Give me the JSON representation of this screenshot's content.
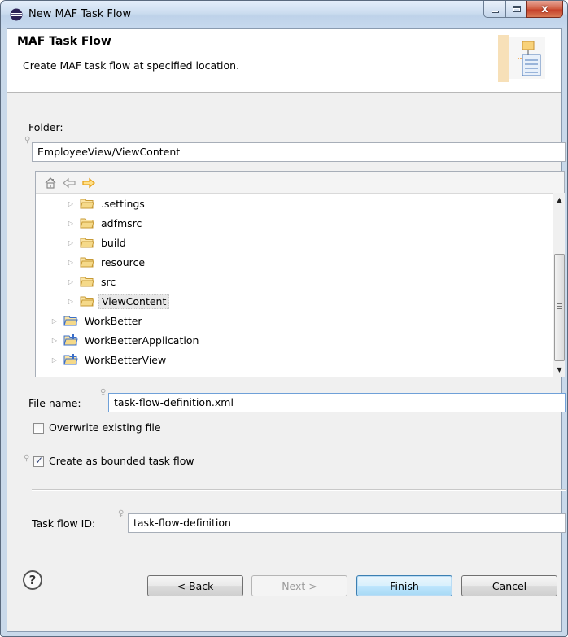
{
  "window": {
    "title": "New MAF Task Flow",
    "close_glyph": "x"
  },
  "header": {
    "title": "MAF Task Flow",
    "description": "Create MAF task flow at specified location."
  },
  "folder": {
    "label": "Folder:",
    "value": "EmployeeView/ViewContent"
  },
  "tree": {
    "items": [
      {
        "label": ".settings",
        "depth": 1
      },
      {
        "label": "adfmsrc",
        "depth": 1
      },
      {
        "label": "build",
        "depth": 1
      },
      {
        "label": "resource",
        "depth": 1
      },
      {
        "label": "src",
        "depth": 1
      },
      {
        "label": "ViewContent",
        "depth": 1,
        "selected": true
      },
      {
        "label": "WorkBetter",
        "depth": 0
      },
      {
        "label": "WorkBetterApplication",
        "depth": 0
      },
      {
        "label": "WorkBetterView",
        "depth": 0
      }
    ]
  },
  "file_name": {
    "label": "File name:",
    "value": "task-flow-definition.xml"
  },
  "overwrite": {
    "label": "Overwrite existing file",
    "checked": false
  },
  "bounded": {
    "label": "Create as bounded task flow",
    "checked": true
  },
  "task_flow_id": {
    "label": "Task flow ID:",
    "value": "task-flow-definition"
  },
  "buttons": {
    "help": "?",
    "back": "< Back",
    "next": "Next >",
    "finish": "Finish",
    "cancel": "Cancel"
  },
  "colors": {
    "folder_fill": "#f5d989",
    "folder_outline": "#c79a35",
    "nav_arrow": "#e6a21c",
    "project_blue": "#3a6ec8"
  }
}
